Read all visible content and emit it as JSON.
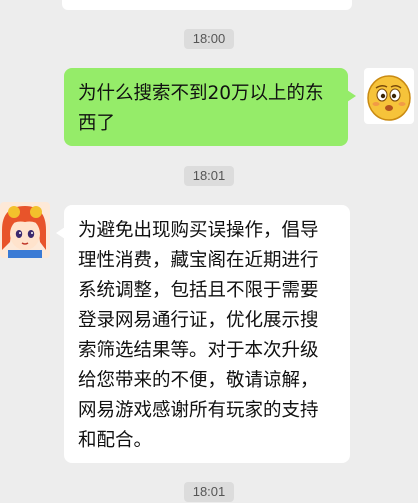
{
  "chat": {
    "timestamps": [
      "18:00",
      "18:01",
      "18:01"
    ],
    "messages": [
      {
        "side": "right",
        "text": "为什么搜索不到20万以上的东西了",
        "avatar_icon": "emoji-face-icon"
      },
      {
        "side": "left",
        "text": "为避免出现购买误操作，倡导理性消费，藏宝阁在近期进行系统调整，包括且不限于需要登录网易通行证，优化展示搜索筛选结果等。对于本次升级给您带来的不便，敬请谅解，网易游戏感谢所有玩家的支持和配合。",
        "avatar_icon": "anime-girl-avatar-icon"
      }
    ]
  },
  "colors": {
    "background": "#ededed",
    "outgoing_bubble": "#95ec69",
    "incoming_bubble": "#ffffff",
    "timestamp_bg": "#dcdcdc"
  }
}
